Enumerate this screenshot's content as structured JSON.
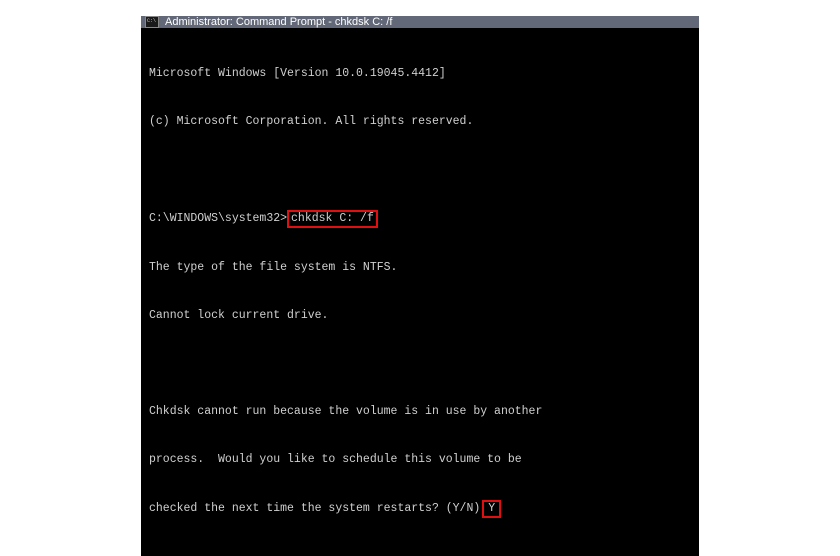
{
  "titlebar": {
    "title": "Administrator: Command Prompt - chkdsk  C: /f"
  },
  "terminal": {
    "version_line": "Microsoft Windows [Version 10.0.19045.4412]",
    "copyright_line": "(c) Microsoft Corporation. All rights reserved.",
    "prompt_path": "C:\\WINDOWS\\system32>",
    "command": "chkdsk C: /f",
    "fs_type_line": "The type of the file system is NTFS.",
    "lock_line": "Cannot lock current drive.",
    "msg_line1": "Chkdsk cannot run because the volume is in use by another",
    "msg_line2": "process.  Would you like to schedule this volume to be",
    "msg_line3_prefix": "checked the next time the system restarts? (Y/N)",
    "answer": "Y"
  }
}
